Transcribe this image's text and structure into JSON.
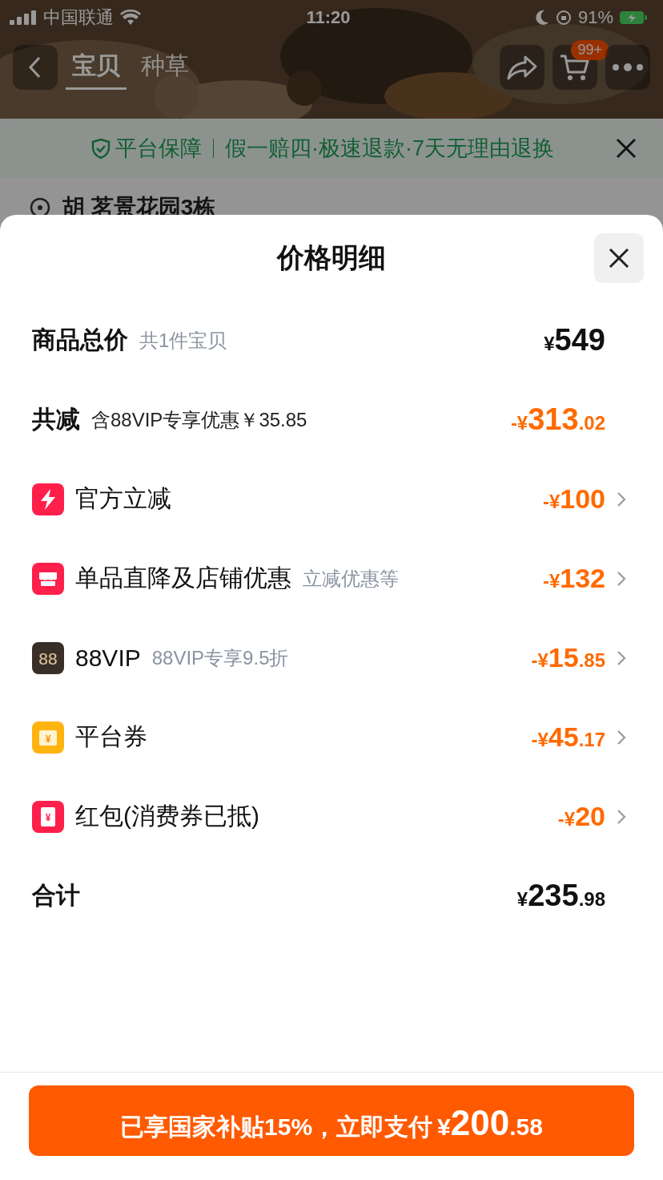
{
  "status_bar": {
    "carrier": "中国联通",
    "time": "11:20",
    "battery": "91%"
  },
  "nav": {
    "tabs": [
      {
        "label": "宝贝",
        "selected": true
      },
      {
        "label": "种草",
        "selected": false
      }
    ],
    "cart_badge": "99+"
  },
  "guarantee": {
    "title": "平台保障",
    "detail": "假一赔四·极速退款·7天无理由退换"
  },
  "address": "胡 茗景花园3栋",
  "sheet": {
    "title": "价格明细",
    "subtotal": {
      "label": "商品总价",
      "note": "共1件宝贝",
      "amount": {
        "sign": "¥",
        "integer": "549"
      }
    },
    "discount": {
      "label": "共减",
      "note": "含88VIP专享优惠￥35.85",
      "amount": {
        "sign": "-¥",
        "integer": "313",
        "decimal": ".02"
      }
    },
    "items": [
      {
        "kind": "flash",
        "label": "官方立减",
        "amount": {
          "sign": "-¥",
          "integer": "100"
        }
      },
      {
        "kind": "store",
        "label": "单品直降及店铺优惠",
        "note": "立减优惠等",
        "amount": {
          "sign": "-¥",
          "integer": "132"
        }
      },
      {
        "kind": "vip",
        "icon_text": "88",
        "label": "88VIP",
        "note": "88VIP专享9.5折",
        "amount": {
          "sign": "-¥",
          "integer": "15",
          "decimal": ".85"
        }
      },
      {
        "kind": "coupon",
        "icon_text": "¥",
        "label": "平台券",
        "amount": {
          "sign": "-¥",
          "integer": "45",
          "decimal": ".17"
        }
      },
      {
        "kind": "redpacket",
        "icon_text": "¥",
        "label": "红包(消费券已抵)",
        "amount": {
          "sign": "-¥",
          "integer": "20"
        }
      }
    ],
    "total": {
      "label": "合计",
      "amount": {
        "sign": "¥",
        "integer": "235",
        "decimal": ".98"
      }
    },
    "pay_button": {
      "label": "已享国家补贴15%，立即支付",
      "amount": {
        "sign": "¥",
        "integer": "200",
        "decimal": ".58"
      }
    }
  }
}
